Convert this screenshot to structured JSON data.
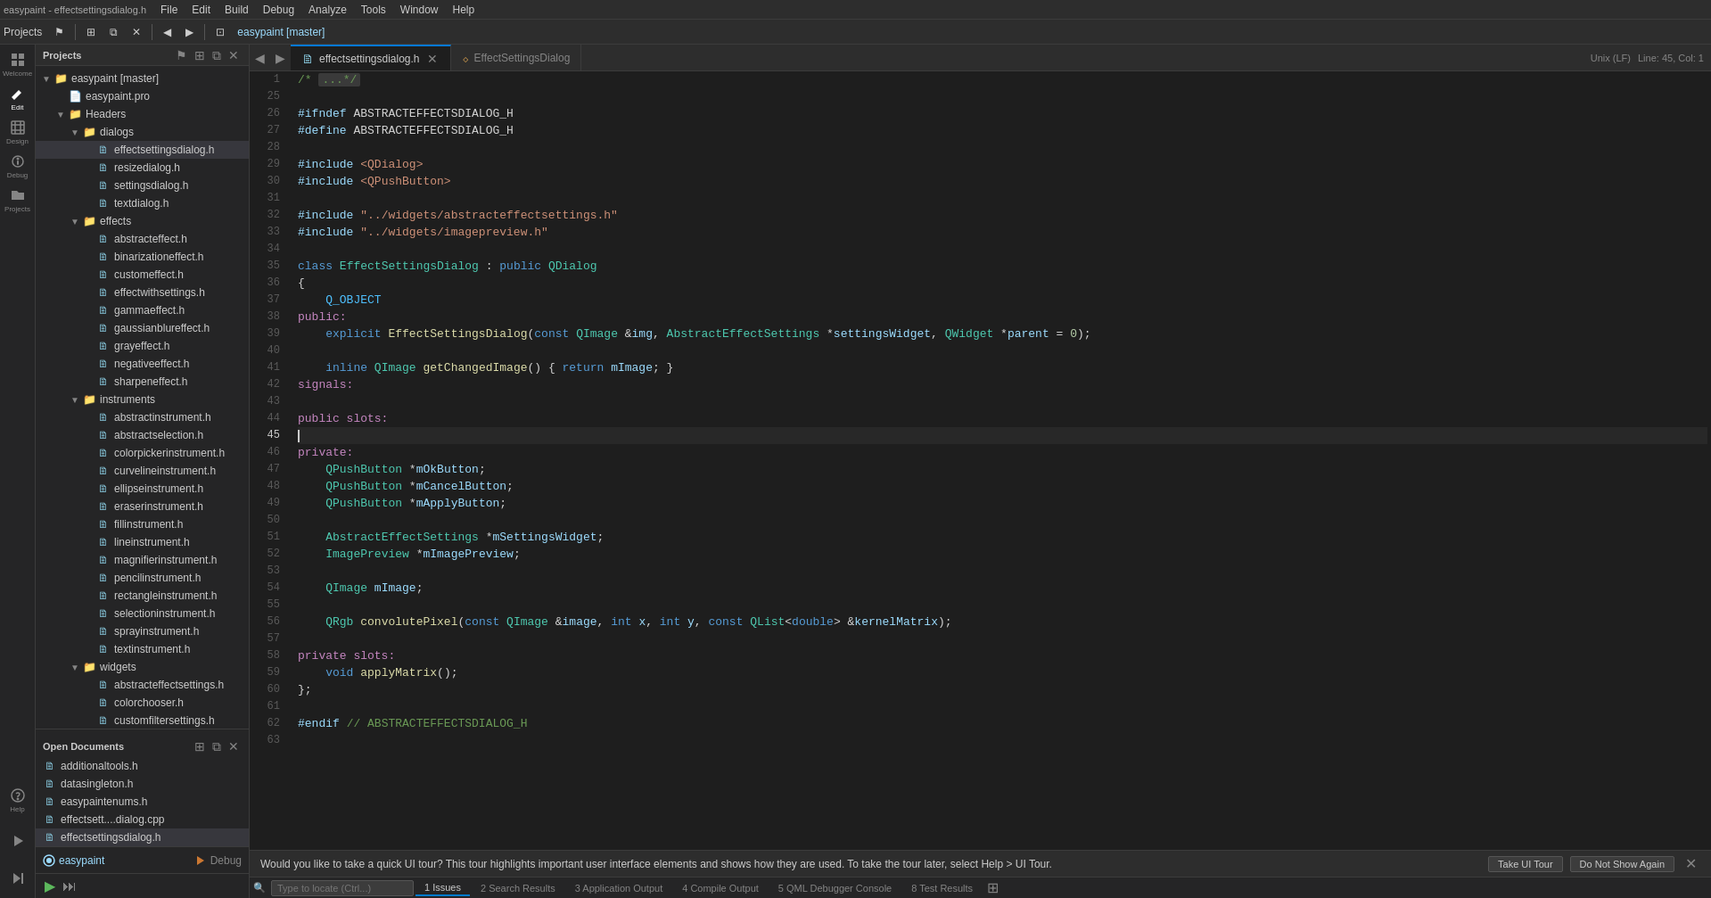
{
  "menubar": {
    "items": [
      "File",
      "Edit",
      "Build",
      "Debug",
      "Analyze",
      "Tools",
      "Window",
      "Help"
    ]
  },
  "toolbar": {
    "project_label": "Projects",
    "nav_arrows": [
      "◀",
      "▶"
    ],
    "debug_label": "easypaint [master]"
  },
  "tabs": {
    "active_tab": "effectsettingsdialog.h",
    "items": [
      {
        "label": "effectsettingsdialog.h",
        "icon": "📄",
        "has_close": true,
        "active": true
      },
      {
        "label": "EffectSettingsDialog",
        "icon": "⬦",
        "has_close": false,
        "active": false
      }
    ],
    "encoding": "Unix (LF)",
    "position": "Line: 45, Col: 1"
  },
  "sidebar": {
    "icons": [
      {
        "name": "welcome-icon",
        "label": "Welcome",
        "symbol": "⊞"
      },
      {
        "name": "edit-icon",
        "label": "Edit",
        "symbol": "✏"
      },
      {
        "name": "design-icon",
        "label": "Design",
        "symbol": "◻"
      },
      {
        "name": "debug-icon",
        "label": "Debug",
        "symbol": "🐛"
      },
      {
        "name": "projects-icon",
        "label": "Projects",
        "symbol": "📁"
      },
      {
        "name": "help-icon",
        "label": "Help",
        "symbol": "?"
      }
    ]
  },
  "projects_panel": {
    "title": "Projects",
    "root": "easypaint [master]",
    "children": {
      "easypaintpro": "easypaint.pro",
      "headers": {
        "label": "Headers",
        "dialogs": {
          "label": "dialogs",
          "files": [
            "effectsettingsdialog.h",
            "resizedialog.h",
            "settingsdialog.h",
            "textdialog.h"
          ]
        },
        "effects": {
          "label": "effects",
          "files": [
            "abstracteffect.h",
            "binarizationeffect.h",
            "customeffect.h",
            "effectwithsettings.h",
            "gammaeffect.h",
            "gaussianblureffect.h",
            "grayeffect.h",
            "negativeeffect.h",
            "sharpeneffect.h"
          ]
        },
        "instruments": {
          "label": "instruments",
          "files": [
            "abstractinstrument.h",
            "abstractselection.h",
            "colorpickerinstrument.h",
            "curvelineinstrument.h",
            "ellipseinstrument.h",
            "eraserinstrument.h",
            "fillinstrument.h",
            "lineinstrument.h",
            "magnifierinstrument.h",
            "pencilinstrument.h",
            "rectangleinstrument.h",
            "selectioninstrument.h",
            "sprayinstrument.h",
            "textinstrument.h"
          ]
        },
        "widgets": {
          "label": "widgets",
          "files": [
            "abstracteffectsettings.h",
            "colorchooser.h",
            "customfiltersettings.h"
          ]
        }
      }
    }
  },
  "open_docs": {
    "title": "Open Documents",
    "files": [
      "additionaltools.h",
      "datasingleton.h",
      "easypaintenums.h",
      "effectsett....dialog.cpp",
      "effectsettingsdialog.h"
    ]
  },
  "code": {
    "filename": "effectsettingsdialog.h",
    "lines": [
      {
        "num": 1,
        "content": "/* {...*/"
      },
      {
        "num": 25,
        "content": ""
      },
      {
        "num": 26,
        "content": "#ifndef ABSTRACTEFFECTSDIALOG_H"
      },
      {
        "num": 27,
        "content": "#define ABSTRACTEFFECTSDIALOG_H"
      },
      {
        "num": 28,
        "content": ""
      },
      {
        "num": 29,
        "content": "#include <QDialog>"
      },
      {
        "num": 30,
        "content": "#include <QPushButton>"
      },
      {
        "num": 31,
        "content": ""
      },
      {
        "num": 32,
        "content": "#include \"../widgets/abstracteffectsettings.h\""
      },
      {
        "num": 33,
        "content": "#include \"../widgets/imagepreview.h\""
      },
      {
        "num": 34,
        "content": ""
      },
      {
        "num": 35,
        "content": "class EffectSettingsDialog : public QDialog"
      },
      {
        "num": 36,
        "content": "{"
      },
      {
        "num": 37,
        "content": "    Q_OBJECT"
      },
      {
        "num": 38,
        "content": "public:"
      },
      {
        "num": 39,
        "content": "    explicit EffectSettingsDialog(const QImage &img, AbstractEffectSettings *settingsWidget, QWidget *parent = 0);"
      },
      {
        "num": 40,
        "content": ""
      },
      {
        "num": 41,
        "content": "    inline QImage getChangedImage() { return mImage; }"
      },
      {
        "num": 42,
        "content": "signals:"
      },
      {
        "num": 43,
        "content": ""
      },
      {
        "num": 44,
        "content": "public slots:"
      },
      {
        "num": 45,
        "content": "|",
        "is_current": true
      },
      {
        "num": 46,
        "content": "private:"
      },
      {
        "num": 47,
        "content": "    QPushButton *mOkButton;"
      },
      {
        "num": 48,
        "content": "    QPushButton *mCancelButton;"
      },
      {
        "num": 49,
        "content": "    QPushButton *mApplyButton;"
      },
      {
        "num": 50,
        "content": ""
      },
      {
        "num": 51,
        "content": "    AbstractEffectSettings *mSettingsWidget;"
      },
      {
        "num": 52,
        "content": "    ImagePreview *mImagePreview;"
      },
      {
        "num": 53,
        "content": ""
      },
      {
        "num": 54,
        "content": "    QImage mImage;"
      },
      {
        "num": 55,
        "content": ""
      },
      {
        "num": 56,
        "content": "    QRgb convolutePixel(const QImage &image, int x, int y, const QList<double> &kernelMatrix);"
      },
      {
        "num": 57,
        "content": ""
      },
      {
        "num": 58,
        "content": "private slots:"
      },
      {
        "num": 59,
        "content": "    void applyMatrix();"
      },
      {
        "num": 60,
        "content": "};"
      },
      {
        "num": 61,
        "content": ""
      },
      {
        "num": 62,
        "content": "#endif // ABSTRACTEFFECTSDIALOG_H"
      },
      {
        "num": 63,
        "content": ""
      }
    ]
  },
  "notification": {
    "text": "Would you like to take a quick UI tour? This tour highlights important user interface elements and shows how they are used. To take the tour later, select Help > UI Tour.",
    "take_tour_btn": "Take UI Tour",
    "dismiss_btn": "Do Not Show Again"
  },
  "bottom_tabs": {
    "items": [
      {
        "num": 1,
        "label": "Issues"
      },
      {
        "num": 2,
        "label": "Search Results"
      },
      {
        "num": 3,
        "label": "Application Output"
      },
      {
        "num": 4,
        "label": "Compile Output"
      },
      {
        "num": 5,
        "label": "QML Debugger Console"
      },
      {
        "num": 8,
        "label": "Test Results"
      }
    ]
  },
  "status_bar": {
    "left_items": [
      "easypaint",
      "Debug"
    ],
    "right_items": []
  }
}
